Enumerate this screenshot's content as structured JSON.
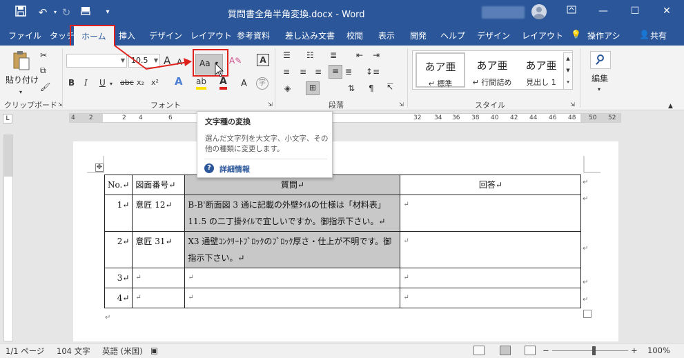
{
  "titlebar": {
    "title": "質問書全角半角変換.docx  -  Word",
    "save_glyph": "💾",
    "undo_glyph": "↶",
    "redo_glyph": "↻",
    "qat_glyph": "▾"
  },
  "tabs": [
    {
      "label": "ファイル"
    },
    {
      "label": "タッチ"
    },
    {
      "label": "ホーム"
    },
    {
      "label": "挿入"
    },
    {
      "label": "デザイン"
    },
    {
      "label": "レイアウト"
    },
    {
      "label": "参考資料"
    },
    {
      "label": "差し込み文書"
    },
    {
      "label": "校閲"
    },
    {
      "label": "表示"
    },
    {
      "label": "開発"
    },
    {
      "label": "ヘルプ"
    },
    {
      "label": "デザイン"
    },
    {
      "label": "レイアウト"
    },
    {
      "label": "操作アシ"
    },
    {
      "label": "共有"
    }
  ],
  "ribbon": {
    "clipboard": {
      "paste_label": "貼り付け",
      "group": "クリップボード"
    },
    "font": {
      "group": "フォント",
      "font_name": "",
      "font_size": "10.5",
      "grow": "A",
      "shrink": "A",
      "change_case": "Aa",
      "bold": "B",
      "italic": "I",
      "underline": "U",
      "strike": "abc",
      "subscript": "x₂",
      "superscript": "x²",
      "text_effects": "A",
      "highlight": "ab",
      "font_color": "A",
      "clear": "A"
    },
    "paragraph": {
      "group": "段落"
    },
    "styles": {
      "group": "スタイル",
      "items": [
        {
          "preview": "あア亜",
          "name": "↵ 標準"
        },
        {
          "preview": "あア亜",
          "name": "↵ 行間詰め"
        },
        {
          "preview": "あア亜",
          "name": "見出し 1"
        }
      ]
    },
    "editing": {
      "label": "編集"
    }
  },
  "tooltip": {
    "title": "文字種の変換",
    "body": "選んだ文字列を大文字、小文字、その他の種類に変更します。",
    "link": "詳細情報",
    "help_glyph": "?"
  },
  "ruler": {
    "numbers": [
      "4",
      "2",
      "",
      "2",
      "4",
      "6",
      "",
      "",
      "",
      "",
      "",
      "",
      "",
      "",
      "",
      "",
      "",
      "",
      "",
      "",
      "",
      "",
      "",
      "",
      "",
      "32",
      "34",
      "36",
      "38",
      "40",
      "42",
      "44",
      "46",
      "48",
      "50",
      "52"
    ],
    "corner": "L"
  },
  "table": {
    "header": [
      "No.↵",
      "図面番号↵",
      "質問↵",
      "回答↵"
    ],
    "rows": [
      {
        "no": "1↵",
        "drawing": "意匠 12↵",
        "question": "B-B'断面図 3 通に記載の外壁ﾀｲﾙの仕様は「材料表」11.5 の二丁掛ﾀｲﾙで宜しいですか。御指示下さい。↵",
        "answer": "↵"
      },
      {
        "no": "2↵",
        "drawing": "意匠 31↵",
        "question": "X3 通壁ｺﾝｸﾘｰﾄﾌﾞﾛｯｸのﾌﾞﾛｯｸ厚さ・仕上が不明です。御指示下さい。↵",
        "answer": "↵"
      },
      {
        "no": "3↵",
        "drawing": "↵",
        "question": "↵",
        "answer": "↵"
      },
      {
        "no": "4↵",
        "drawing": "↵",
        "question": "↵",
        "answer": "↵"
      }
    ],
    "row_end": "↵",
    "after": "↵"
  },
  "status": {
    "page": "1/1 ページ",
    "words": "104 文字",
    "lang": "英語 (米国)",
    "zoom": "100%",
    "minus": "−",
    "plus": "+"
  },
  "colors": {
    "brand": "#2b579a",
    "highlight_box": "#e0201c"
  }
}
